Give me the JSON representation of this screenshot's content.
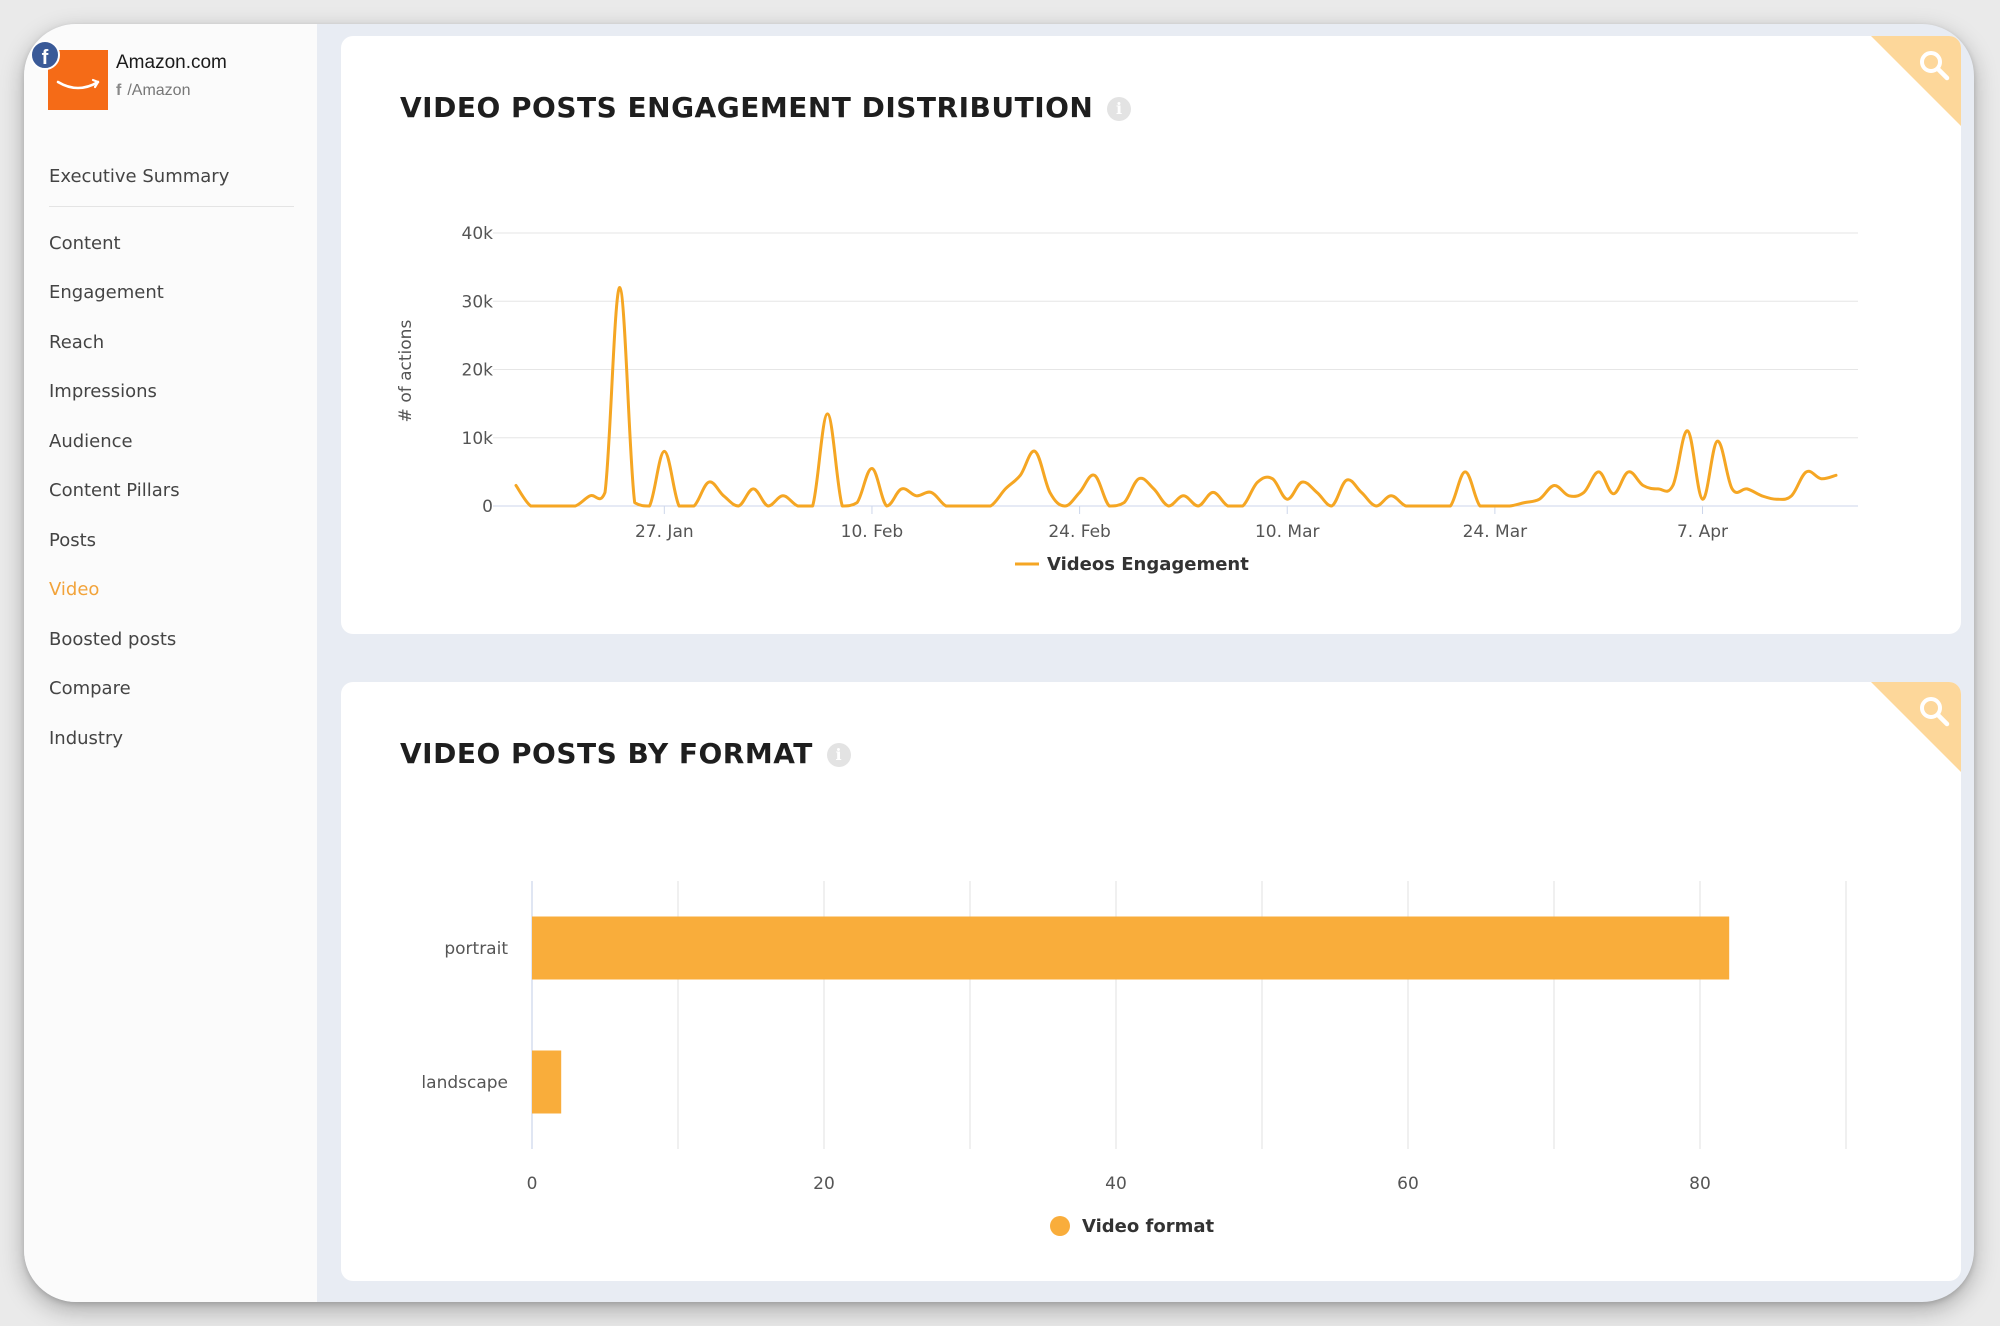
{
  "brand": {
    "name": "Amazon.com",
    "handle": "/Amazon",
    "network_icon": "facebook-icon",
    "logo_color": "#f56b17"
  },
  "sidebar": {
    "summary": "Executive Summary",
    "items": [
      {
        "label": "Content"
      },
      {
        "label": "Engagement"
      },
      {
        "label": "Reach"
      },
      {
        "label": "Impressions"
      },
      {
        "label": "Audience"
      },
      {
        "label": "Content Pillars"
      },
      {
        "label": "Posts"
      },
      {
        "label": "Video",
        "active": true
      },
      {
        "label": "Boosted posts"
      },
      {
        "label": "Compare"
      },
      {
        "label": "Industry"
      }
    ]
  },
  "colors": {
    "accent": "#f2a33a",
    "line": "#f5a623",
    "bar": "#f9ad3b"
  },
  "cards": {
    "engagement": {
      "title": "VIDEO POSTS ENGAGEMENT DISTRIBUTION",
      "icons": [
        "info-icon",
        "search-icon"
      ]
    },
    "format": {
      "title": "VIDEO POSTS BY FORMAT",
      "icons": [
        "info-icon",
        "search-icon"
      ]
    }
  },
  "chart_data": [
    {
      "type": "line",
      "title": "VIDEO POSTS ENGAGEMENT DISTRIBUTION",
      "ylabel": "# of actions",
      "ylim": [
        0,
        40000
      ],
      "y_ticks": [
        "0",
        "10k",
        "20k",
        "30k",
        "40k"
      ],
      "x_ticks": [
        "27. Jan",
        "10. Feb",
        "24. Feb",
        "10. Mar",
        "24. Mar",
        "7. Apr"
      ],
      "x_tick_days": [
        10,
        24,
        38,
        52,
        66,
        80
      ],
      "x_range_days": [
        0,
        89
      ],
      "grid": true,
      "legend_position": "bottom",
      "series": [
        {
          "name": "Videos Engagement",
          "x_days": [
            0,
            1,
            2,
            3,
            4,
            5,
            6,
            7,
            8,
            9,
            10,
            11,
            12,
            13,
            14,
            15,
            16,
            17,
            18,
            19,
            20,
            21,
            22,
            23,
            24,
            25,
            26,
            27,
            28,
            29,
            30,
            31,
            32,
            33,
            34,
            35,
            36,
            37,
            38,
            39,
            40,
            41,
            42,
            43,
            44,
            45,
            46,
            47,
            48,
            49,
            50,
            51,
            52,
            53,
            54,
            55,
            56,
            57,
            58,
            59,
            60,
            61,
            62,
            63,
            64,
            65,
            66,
            67,
            68,
            69,
            70,
            71,
            72,
            73,
            74,
            75,
            76,
            77,
            78,
            79,
            80,
            81,
            82,
            83,
            84,
            85,
            86,
            87,
            88,
            89
          ],
          "values": [
            3000,
            0,
            0,
            0,
            0,
            1500,
            2000,
            32000,
            500,
            0,
            8000,
            0,
            0,
            3500,
            1500,
            0,
            2500,
            0,
            1500,
            0,
            0,
            13500,
            0,
            500,
            5500,
            0,
            2500,
            1500,
            2000,
            0,
            0,
            0,
            0,
            2500,
            4500,
            8000,
            2000,
            0,
            2000,
            4500,
            0,
            500,
            4000,
            2500,
            0,
            1500,
            0,
            2000,
            0,
            0,
            3500,
            4000,
            1000,
            3500,
            2000,
            0,
            3800,
            2000,
            0,
            1500,
            0,
            0,
            0,
            0,
            5000,
            0,
            0,
            0,
            500,
            1000,
            3000,
            1500,
            2000,
            5000,
            1800,
            5000,
            3000,
            2500,
            3000,
            11000,
            1000,
            9500,
            2500,
            2500,
            1500,
            1000,
            1500,
            5000,
            4000,
            4500
          ]
        }
      ]
    },
    {
      "type": "bar",
      "orientation": "horizontal",
      "title": "VIDEO POSTS BY FORMAT",
      "categories": [
        "portrait",
        "landscape"
      ],
      "xlim": [
        0,
        90
      ],
      "x_ticks": [
        0,
        20,
        40,
        60,
        80
      ],
      "grid": true,
      "legend_position": "bottom",
      "series": [
        {
          "name": "Video format",
          "values": [
            82,
            2
          ]
        }
      ]
    }
  ]
}
